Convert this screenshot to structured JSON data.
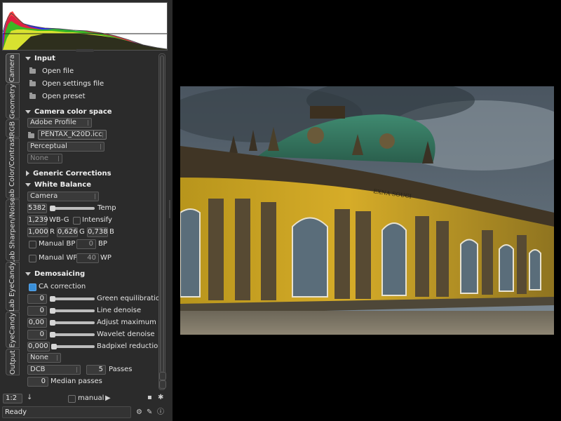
{
  "tabs": [
    "Camera",
    "Geometry",
    "RGB",
    "Lab Color/Contrast",
    "Lab Sharpen/Noise",
    "Lab EyeCandy",
    "EyeCandy",
    "Output"
  ],
  "input": {
    "header": "Input",
    "open_file": "Open file",
    "open_settings": "Open settings file",
    "open_preset": "Open preset"
  },
  "color_space": {
    "header": "Camera color space",
    "profile": "Adobe Profile",
    "icc": "PENTAX_K20D.icc",
    "intent": "Perceptual",
    "none": "None"
  },
  "generic": {
    "header": "Generic Corrections"
  },
  "white_balance": {
    "header": "White Balance",
    "mode": "Camera",
    "temp_value": "5382",
    "temp_label": "Temp",
    "wbg_value": "1,239",
    "wbg_label": "WB-G",
    "intensify_label": "Intensify",
    "r_value": "1,000",
    "r_label": "R",
    "g_value": "0,626",
    "g_label": "G",
    "b_value": "0,738",
    "b_label": "B",
    "manual_bp_label": "Manual BP",
    "bp_value": "0",
    "bp_label": "BP",
    "manual_wp_label": "Manual WP",
    "wp_value": "40",
    "wp_label": "WP"
  },
  "demosaicing": {
    "header": "Demosaicing",
    "ca_label": "CA correction",
    "green_value": "0",
    "green_label": "Green equilibration",
    "line_value": "0",
    "line_label": "Line denoise",
    "adjmax_value": "0,00",
    "adjmax_label": "Adjust maximum",
    "wavelet_value": "0",
    "wavelet_label": "Wavelet denoise",
    "badpixel_value": "0,000",
    "badpixel_label": "Badpixel reduction",
    "none": "None",
    "algo": "DCB",
    "passes_value": "5",
    "passes_label": "Passes",
    "median_value": "0",
    "median_label": "Median passes"
  },
  "bottom": {
    "zoom": "1:2",
    "manual_label": "manual",
    "status": "Ready"
  },
  "image_text": "EXNA SOUCI"
}
